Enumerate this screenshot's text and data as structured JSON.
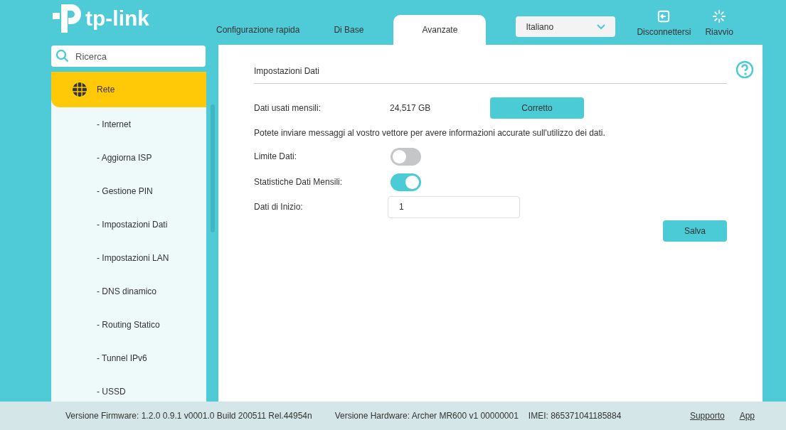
{
  "logo": {
    "text": "tp-link"
  },
  "tabs": [
    {
      "label": "Configurazione rapida",
      "selected": false
    },
    {
      "label": "Di Base",
      "selected": false
    },
    {
      "label": "Avanzate",
      "selected": true
    }
  ],
  "language": {
    "value": "Italiano"
  },
  "header_actions": [
    {
      "kind": "logout",
      "label": "Disconnettersi"
    },
    {
      "kind": "reboot",
      "label": "Riavvio"
    }
  ],
  "sidebar": {
    "search": {
      "placeholder": "Ricerca"
    },
    "items": [
      {
        "label": "Rete",
        "selected": true,
        "children": [
          {
            "label": "- Internet",
            "selected": false
          },
          {
            "label": "- Aggiorna ISP",
            "selected": false
          },
          {
            "label": "- Gestione PIN",
            "selected": false
          },
          {
            "label": "- Impostazioni Dati",
            "selected": false
          },
          {
            "label": "- Impostazioni LAN",
            "selected": false
          },
          {
            "label": "- DNS dinamico",
            "selected": false
          },
          {
            "label": "- Routing Statico",
            "selected": false
          },
          {
            "label": "- Tunnel IPv6",
            "selected": false
          },
          {
            "label": "- USSD",
            "selected": false
          }
        ]
      }
    ]
  },
  "section": {
    "title": "Impostazioni Dati",
    "rows": [
      {
        "kind": "value",
        "label": "Dati usati mensili:",
        "value": "24,517 GB",
        "button": "Corretto"
      },
      {
        "kind": "note",
        "text": "Potete inviare messaggi al vostro vettore per avere informazioni accurate sull'utilizzo dei dati."
      },
      {
        "kind": "toggle",
        "label": "Limite Dati:",
        "on": false
      },
      {
        "kind": "toggle",
        "label": "Statistiche Dati Mensili:",
        "on": true
      },
      {
        "kind": "input",
        "label": "Dati di Inizio:",
        "value": "1"
      }
    ],
    "save": "Salva"
  },
  "footer": {
    "firmware": "Versione Firmware: 1.2.0 0.9.1 v0001.0 Build 200511 Rel.44954n",
    "hardware": "Versione Hardware: Archer MR600 v1 00000001",
    "imei": "IMEI: 865371041185884",
    "links": [
      "Supporto",
      "App"
    ]
  }
}
